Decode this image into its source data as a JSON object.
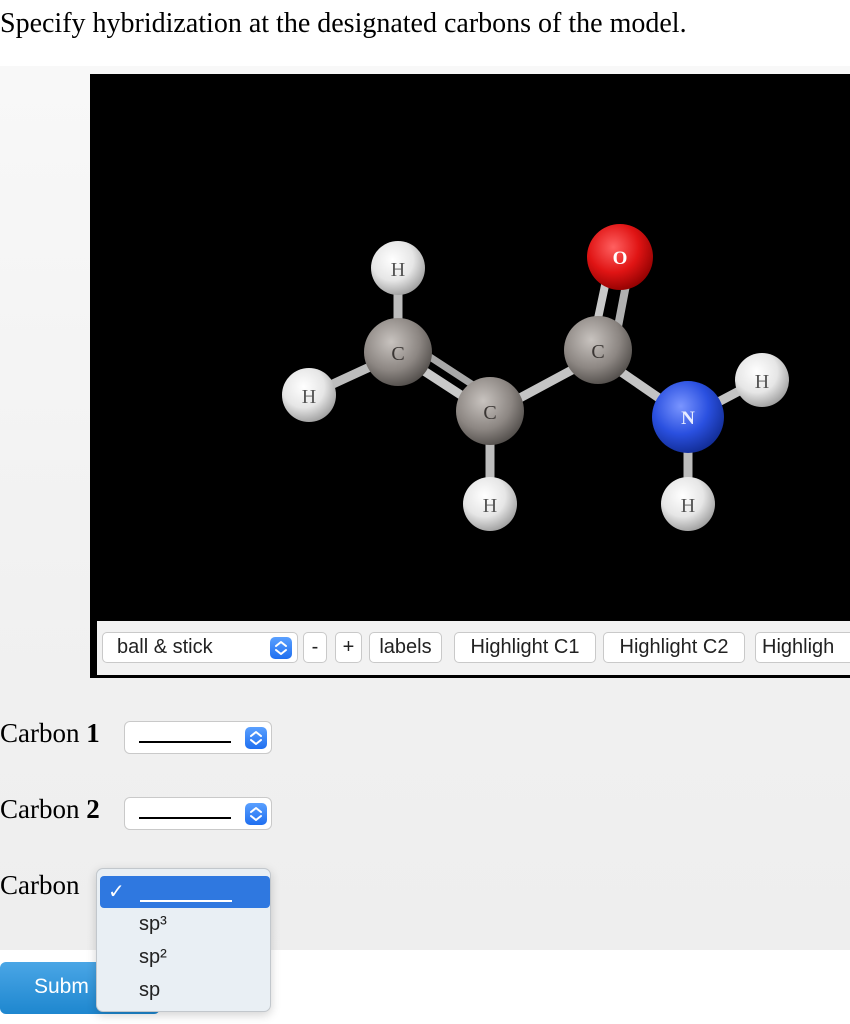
{
  "question": "Specify hybridization at the designated carbons of the model.",
  "molecule": {
    "atoms": [
      {
        "label": "H",
        "color": "#ffffff"
      },
      {
        "label": "C",
        "color": "#8a8480"
      },
      {
        "label": "H",
        "color": "#ffffff"
      },
      {
        "label": "C",
        "color": "#8a8480"
      },
      {
        "label": "H",
        "color": "#ffffff"
      },
      {
        "label": "C",
        "color": "#8a8480"
      },
      {
        "label": "O",
        "color": "#e01818"
      },
      {
        "label": "N",
        "color": "#2a50e0"
      },
      {
        "label": "H",
        "color": "#ffffff"
      },
      {
        "label": "H",
        "color": "#ffffff"
      }
    ]
  },
  "controls": {
    "display_mode": "ball & stick",
    "zoom_out": "-",
    "zoom_in": "+",
    "labels": "labels",
    "highlight_c1": "Highlight C1",
    "highlight_c2": "Highlight C2",
    "highlight_c3": "Highligh"
  },
  "carbons": [
    {
      "label": "Carbon",
      "number": "1",
      "value": "_______"
    },
    {
      "label": "Carbon",
      "number": "2",
      "value": "_______"
    },
    {
      "label": "Carbon",
      "number": "",
      "value": "_______"
    }
  ],
  "dropdown": {
    "selected_mark": "✓",
    "options": [
      "sp³",
      "sp²",
      "sp"
    ]
  },
  "submit": "Subm"
}
